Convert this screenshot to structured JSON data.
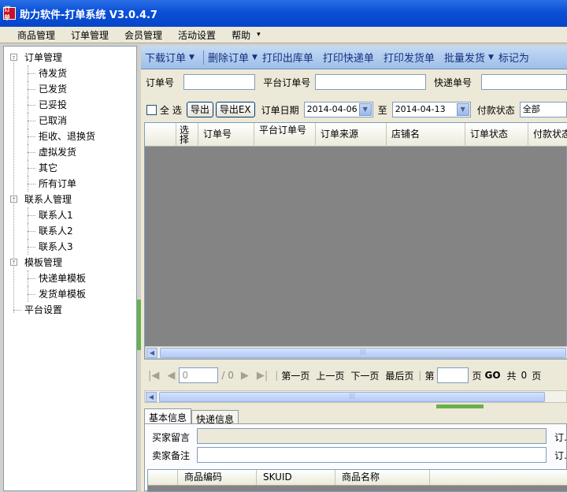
{
  "window": {
    "title": "助力软件-打单系统 V3.0.4.7",
    "icon_text": "订单"
  },
  "menu": [
    "商品管理",
    "订单管理",
    "会员管理",
    "活动设置",
    "帮助",
    "▾"
  ],
  "tree": [
    {
      "label": "订单管理",
      "level": 0,
      "expander": "⊟"
    },
    {
      "label": "待发货",
      "level": 1
    },
    {
      "label": "已发货",
      "level": 1
    },
    {
      "label": "已妥投",
      "level": 1
    },
    {
      "label": "已取消",
      "level": 1
    },
    {
      "label": "拒收、退换货",
      "level": 1
    },
    {
      "label": "虚拟发货",
      "level": 1
    },
    {
      "label": "其它",
      "level": 1
    },
    {
      "label": "所有订单",
      "level": 1
    },
    {
      "label": "联系人管理",
      "level": 0,
      "expander": "⊟"
    },
    {
      "label": "联系人1",
      "level": 1
    },
    {
      "label": "联系人2",
      "level": 1
    },
    {
      "label": "联系人3",
      "level": 1
    },
    {
      "label": "模板管理",
      "level": 0,
      "expander": "⊟"
    },
    {
      "label": "快递单模板",
      "level": 1
    },
    {
      "label": "发货单模板",
      "level": 1
    },
    {
      "label": "平台设置",
      "level": 0
    }
  ],
  "toolbar": {
    "download": "下载订单",
    "delete": "删除订单",
    "print_outbound": "打印出库单",
    "print_express": "打印快递单",
    "print_delivery": "打印发货单",
    "batch_ship": "批量发货",
    "mark": "标记为"
  },
  "filters": {
    "order_no_label": "订单号",
    "order_no_value": "",
    "platform_no_label": "平台订单号",
    "platform_no_value": "",
    "express_no_label": "快递单号",
    "express_no_value": "",
    "select_all_label": "全 选",
    "export": "导出",
    "export_ex": "导出EX",
    "date_label": "订单日期",
    "date_from": "2014-04-06",
    "to_label": "至",
    "date_to": "2014-04-13",
    "pay_status_label": "付款状态",
    "pay_status_value": "全部"
  },
  "grid": {
    "columns": [
      "选择",
      "订单号",
      "平台订单号",
      "订单来源",
      "店铺名",
      "订单状态",
      "付款状态"
    ],
    "rows": []
  },
  "pager": {
    "current": "0",
    "total_text": "/ 0",
    "first": "第一页",
    "prev": "上一页",
    "next": "下一页",
    "last": "最后页",
    "goto_prefix": "第",
    "goto_value": "",
    "goto_suffix": "页",
    "go": "GO",
    "count_prefix": "共",
    "count": "0",
    "count_suffix": "页"
  },
  "detail_tabs": [
    "基本信息",
    "快递信息"
  ],
  "detail": {
    "buyer_msg_label": "买家留言",
    "seller_note_label": "卖家备注",
    "right_label_1": "订...",
    "right_label_2": "订...",
    "sub_columns": [
      "商品编码",
      "SKUID",
      "商品名称"
    ]
  }
}
